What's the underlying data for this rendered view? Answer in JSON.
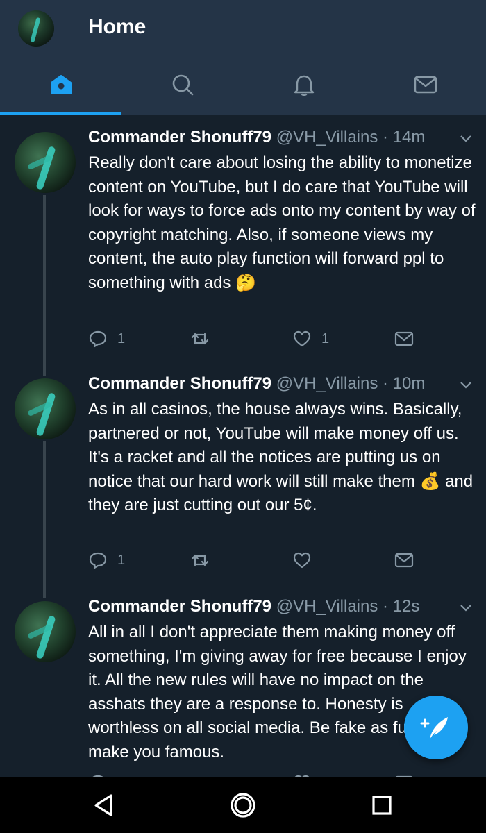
{
  "header": {
    "title": "Home",
    "tabs": [
      {
        "name": "home",
        "icon": "home-icon",
        "active": true
      },
      {
        "name": "search",
        "icon": "search-icon",
        "active": false
      },
      {
        "name": "notifications",
        "icon": "bell-icon",
        "active": false
      },
      {
        "name": "messages",
        "icon": "mail-icon",
        "active": false
      }
    ]
  },
  "tweets": [
    {
      "name": "Commander Shonuff79",
      "meta": "@VH_Villains · 14m",
      "text": "Really don't care about losing the ability to monetize content on YouTube, but I do care that YouTube will look for ways to force ads onto my content by way of copyright matching. Also, if someone views my content, the auto play function will forward ppl to something with ads 🤔",
      "reply_count": "1",
      "retweet_count": "",
      "like_count": "1"
    },
    {
      "name": "Commander Shonuff79",
      "meta": "@VH_Villains · 10m",
      "text": "As in all casinos, the house always wins. Basically, partnered or not, YouTube will make money off us.  It's a racket and all the notices are putting us on notice that our hard work will still make them 💰 and they are just cutting out our 5¢.",
      "reply_count": "1",
      "retweet_count": "",
      "like_count": ""
    },
    {
      "name": "Commander Shonuff79",
      "meta": "@VH_Villains · 12s",
      "text": "All in all I don't appreciate them making money off something, I'm giving away for free because I enjoy it.  All the new rules will have no impact on the asshats they are a response to.  Honesty is worthless on all social media.  Be fake as fuck, it'll make you famous.",
      "reply_count": "",
      "retweet_count": "",
      "like_count": ""
    }
  ],
  "colors": {
    "background": "#15202b",
    "header_bg": "#243447",
    "accent": "#1da1f2",
    "muted": "#8899a6"
  }
}
